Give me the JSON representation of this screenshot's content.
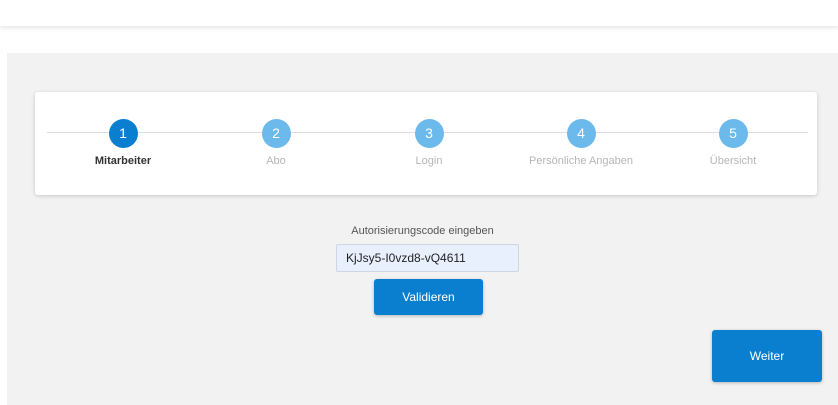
{
  "stepper": {
    "steps": [
      {
        "number": "1",
        "label": "Mitarbeiter",
        "state": "active"
      },
      {
        "number": "2",
        "label": "Abo",
        "state": "pending"
      },
      {
        "number": "3",
        "label": "Login",
        "state": "pending"
      },
      {
        "number": "4",
        "label": "Persönliche Angaben",
        "state": "pending"
      },
      {
        "number": "5",
        "label": "Übersicht",
        "state": "pending"
      }
    ]
  },
  "authorization": {
    "label": "Autorisierungscode eingeben",
    "code_value": "KjJsy5-I0vzd8-vQ4611",
    "validate_label": "Validieren"
  },
  "footer": {
    "next_label": "Weiter"
  },
  "colors": {
    "primary": "#0a7fd0",
    "step_pending": "#6cb9ec",
    "background": "#f2f2f2",
    "input_fill": "#e8f0fe"
  }
}
